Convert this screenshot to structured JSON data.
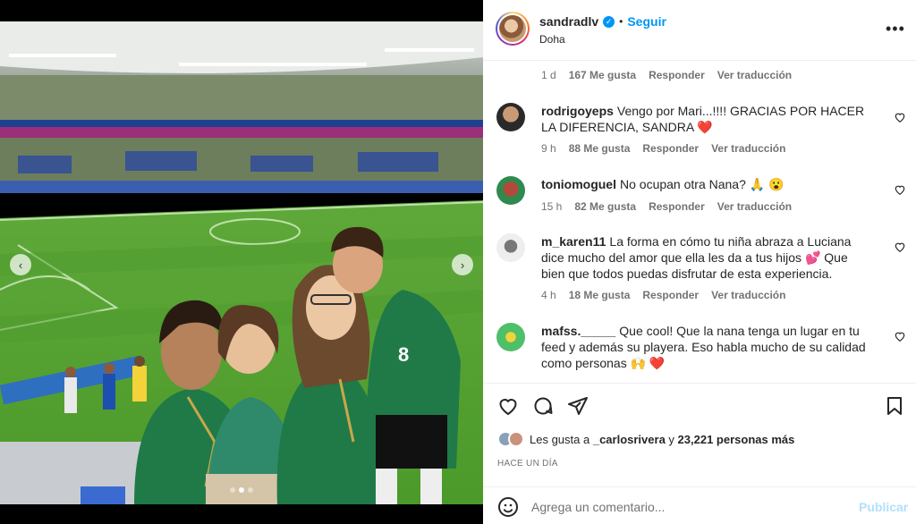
{
  "post": {
    "username": "sandradlv",
    "separator": "•",
    "follow_label": "Seguir",
    "location": "Doha"
  },
  "caption_meta": {
    "time": "1 d",
    "likes": "167 Me gusta",
    "reply": "Responder",
    "translate": "Ver traducción"
  },
  "comments": [
    {
      "username": "rodrigoyeps",
      "text": "Vengo por Mari...!!!! GRACIAS POR HACER LA DIFERENCIA, SANDRA ❤️",
      "time": "9 h",
      "likes": "88 Me gusta",
      "reply": "Responder",
      "translate": "Ver traducción"
    },
    {
      "username": "toniomoguel",
      "text": "No ocupan otra Nana? 🙏 😮",
      "time": "15 h",
      "likes": "82 Me gusta",
      "reply": "Responder",
      "translate": "Ver traducción"
    },
    {
      "username": "m_karen11",
      "text": "La forma en cómo tu niña abraza a Luciana dice mucho del amor que ella les da a tus hijos 💕 Que bien que todos puedas disfrutar de esta experiencia.",
      "time": "4 h",
      "likes": "18 Me gusta",
      "reply": "Responder",
      "translate": "Ver traducción"
    },
    {
      "username": "mafss._____",
      "text": "Que cool! Que la nana tenga un lugar en tu feed y además su playera. Eso habla mucho de su calidad como personas 🙌 ❤️",
      "time": "",
      "likes": "",
      "reply": "",
      "translate": ""
    }
  ],
  "likes_summary": {
    "prefix": "Les gusta a",
    "user": "_carlosrivera",
    "middle": "y",
    "count": "23,221 personas más"
  },
  "time_ago": "HACE UN DÍA",
  "composer": {
    "placeholder": "Agrega un comentario...",
    "publish_label": "Publicar"
  },
  "icons": {
    "verified": "verified-badge-icon",
    "more": "more-options-icon",
    "like": "heart-icon",
    "comment": "comment-bubble-icon",
    "share": "paper-plane-icon",
    "save": "bookmark-icon",
    "emoji": "emoji-smile-icon",
    "prev": "chevron-left-icon",
    "next": "chevron-right-icon"
  },
  "colors": {
    "accent": "#0095f6",
    "heart_red": "#ed4956",
    "publish_disabled": "#b2dffc"
  },
  "carousel": {
    "slides": 3,
    "active": 1
  }
}
